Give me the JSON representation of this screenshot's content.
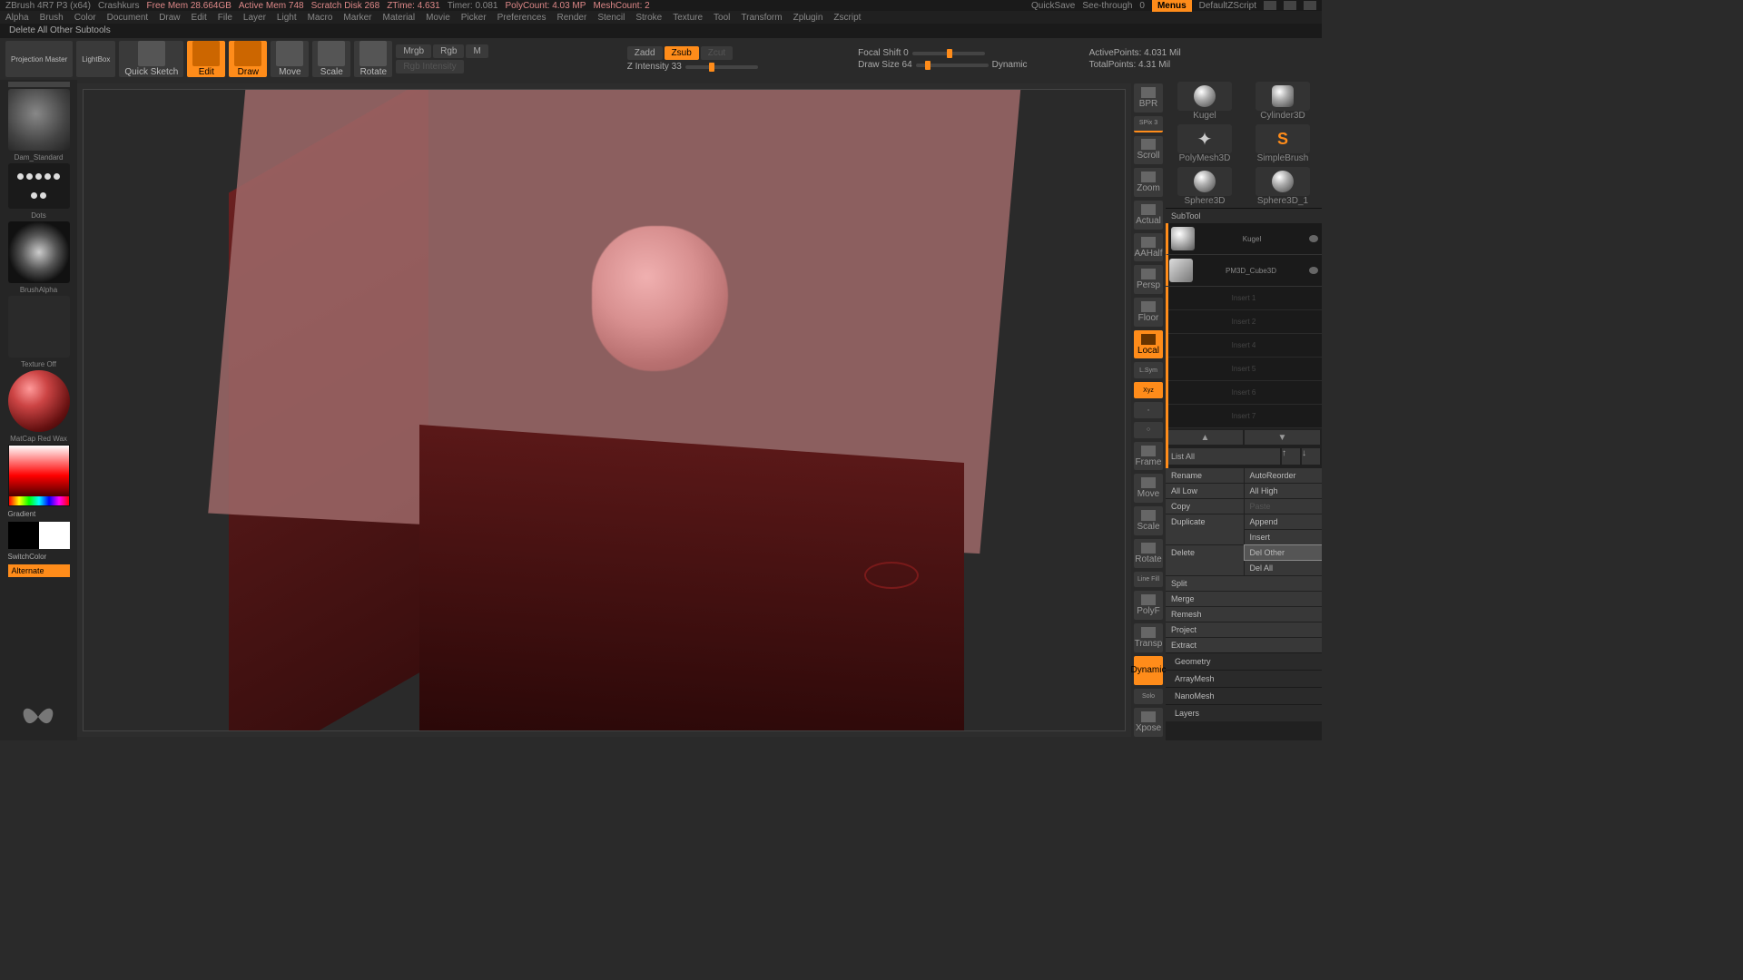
{
  "topbar": {
    "app": "ZBrush 4R7 P3 (x64)",
    "doc": "Crashkurs",
    "mem": "Free Mem 28.664GB",
    "active": "Active Mem 748",
    "scratch": "Scratch Disk 268",
    "ztime": "ZTime: 4.631",
    "timer": "Timer: 0.081",
    "poly": "PolyCount: 4.03 MP",
    "mesh": "MeshCount: 2",
    "quicksave": "QuickSave",
    "seethrough": "See-through",
    "seethrough_val": "0",
    "menus": "Menus",
    "zscript": "DefaultZScript"
  },
  "menubar": [
    "Alpha",
    "Brush",
    "Color",
    "Document",
    "Draw",
    "Edit",
    "File",
    "Layer",
    "Light",
    "Macro",
    "Marker",
    "Material",
    "Movie",
    "Picker",
    "Preferences",
    "Render",
    "Stencil",
    "Stroke",
    "Texture",
    "Tool",
    "Transform",
    "Zplugin",
    "Zscript"
  ],
  "hint": "Delete All Other Subtools",
  "toolbar": {
    "projection": "Projection Master",
    "lightbox": "LightBox",
    "quicksketch": "Quick Sketch",
    "edit": "Edit",
    "draw": "Draw",
    "move": "Move",
    "scale": "Scale",
    "rotate": "Rotate",
    "mrgb": "Mrgb",
    "rgb": "Rgb",
    "m": "M",
    "rgb_intensity": "Rgb Intensity",
    "zadd": "Zadd",
    "zsub": "Zsub",
    "zcut": "Zcut",
    "zintensity": "Z Intensity 33",
    "focal": "Focal Shift 0",
    "drawsize": "Draw Size 64",
    "dynamic": "Dynamic",
    "activepoints": "ActivePoints: 4.031 Mil",
    "totalpoints": "TotalPoints: 4.31 Mil"
  },
  "left": {
    "brush": "Dam_Standard",
    "stroke": "Dots",
    "alpha": "BrushAlpha",
    "texture": "Texture Off",
    "material": "MatCap Red Wax",
    "gradient": "Gradient",
    "switch": "SwitchColor",
    "alternate": "Alternate"
  },
  "shelf": {
    "bpr": "BPR",
    "spix": "SPix 3",
    "scroll": "Scroll",
    "zoom": "Zoom",
    "actual": "Actual",
    "aahalf": "AAHalf",
    "persp": "Persp",
    "floor": "Floor",
    "local": "Local",
    "lsym": "L.Sym",
    "xyz": "Xyz",
    "frame": "Frame",
    "move": "Move",
    "scale": "Scale",
    "rotate": "Rotate",
    "linefill": "Line Fill",
    "polyf": "PolyF",
    "transp": "Transp",
    "dynamic": "Dynamic",
    "solo": "Solo",
    "xpose": "Xpose"
  },
  "tools": {
    "cylinder": "Cylinder3D",
    "polymesh": "PolyMesh3D",
    "simplebrush": "SimpleBrush",
    "sphere": "Sphere3D",
    "sphere3d1": "Sphere3D_1",
    "kugel": "Kugel"
  },
  "subtool": {
    "header": "SubTool",
    "item1": "Kugel",
    "item2": "PM3D_Cube3D",
    "slots": [
      "Insert 1",
      "Insert 2",
      "Insert 4",
      "Insert 5",
      "Insert 6",
      "Insert 7"
    ],
    "listall": "List All",
    "rename": "Rename",
    "autoreorder": "AutoReorder",
    "alllow": "All Low",
    "allhigh": "All High",
    "copy": "Copy",
    "paste": "Paste",
    "duplicate": "Duplicate",
    "append": "Append",
    "insert": "Insert",
    "delete": "Delete",
    "delother": "Del Other",
    "delall": "Del All",
    "split": "Split",
    "merge": "Merge",
    "remesh": "Remesh",
    "project": "Project",
    "extract": "Extract"
  },
  "sections": [
    "Geometry",
    "ArrayMesh",
    "NanoMesh",
    "Layers"
  ]
}
